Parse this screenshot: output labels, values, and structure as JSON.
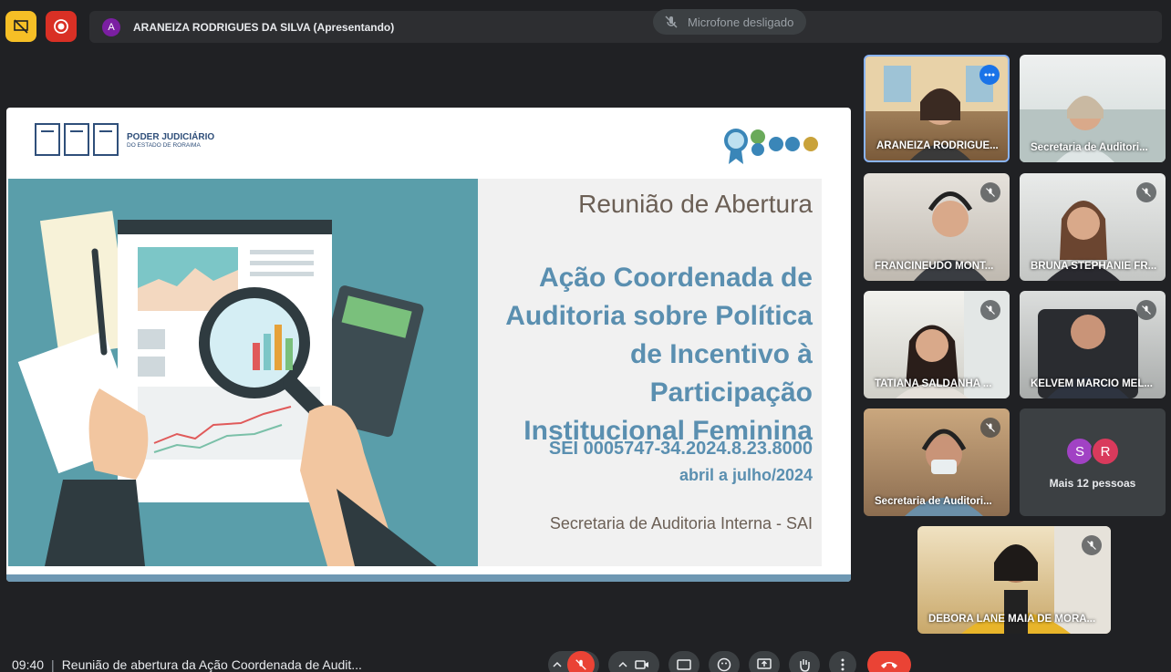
{
  "top_bar": {
    "presenter_initial": "A",
    "presenter_label": "ARANEIZA RODRIGUES DA SILVA (Apresentando)",
    "mic_status_toast": "Microfone desligado"
  },
  "slide": {
    "org_name": "PODER JUDICIÁRIO",
    "org_sub": "DO ESTADO DE RORAIMA",
    "kicker": "Reunião de Abertura",
    "title": "Ação Coordenada de Auditoria sobre Política de Incentivo à Participação Institucional Feminina",
    "sei": "SEI 0005747-34.2024.8.23.8000",
    "period": "abril a julho/2024",
    "footer": "Secretaria de Auditoria Interna - SAI"
  },
  "participants": [
    {
      "name": "ARANEIZA RODRIGUE..."
    },
    {
      "name": "Secretaria de Auditori..."
    },
    {
      "name": "FRANCINEUDO MONT..."
    },
    {
      "name": "BRUNA STEPHANIE FR..."
    },
    {
      "name": "TATIANA SALDANHA ..."
    },
    {
      "name": "KELVEM MARCIO MEL..."
    },
    {
      "name": "Secretaria de Auditori..."
    },
    {
      "name": "DEBORA LANE MAIA DE MORA..."
    }
  ],
  "others": {
    "avatars": [
      "S",
      "R"
    ],
    "label": "Mais 12 pessoas"
  },
  "bottom": {
    "time": "09:40",
    "separator": "|",
    "meeting_title": "Reunião de abertura da Ação Coordenada de Audit..."
  },
  "colors": {
    "background": "#202124",
    "accent": "#8ab4f8",
    "danger": "#ea4335",
    "slide_blue": "#5a8fb0"
  }
}
